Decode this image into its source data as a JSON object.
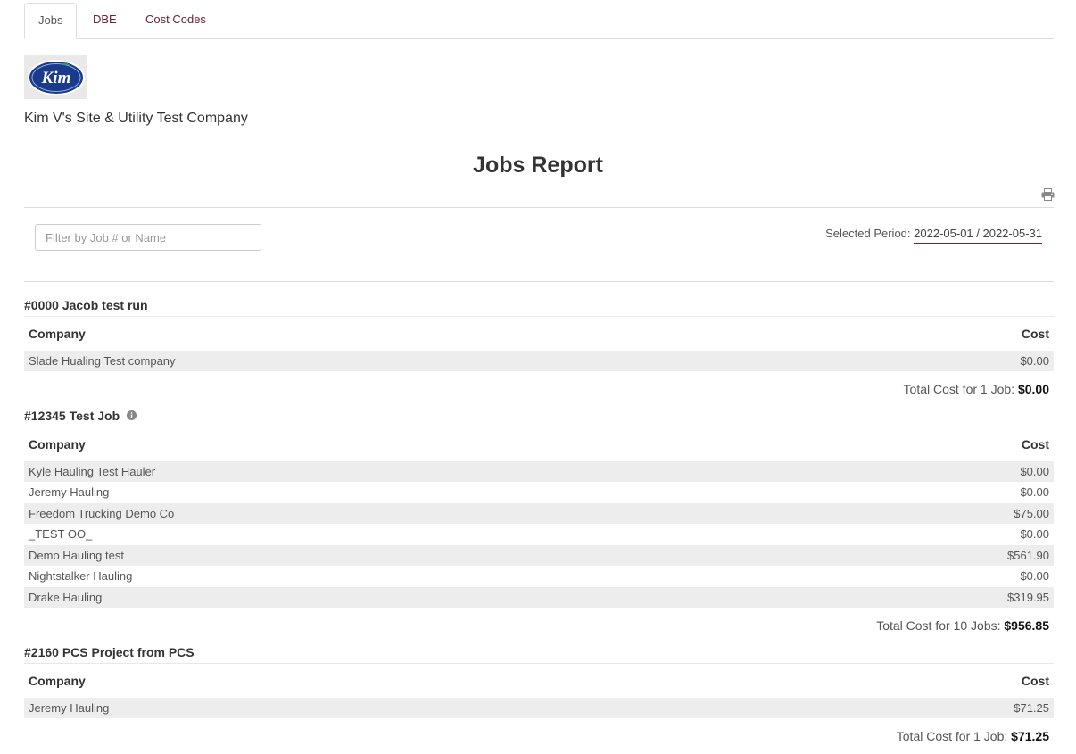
{
  "tabs": [
    {
      "label": "Jobs",
      "active": true
    },
    {
      "label": "DBE",
      "active": false
    },
    {
      "label": "Cost Codes",
      "active": false
    }
  ],
  "logo": {
    "text": "Kim",
    "icon": "company-logo"
  },
  "company": {
    "name": "Kim V's Site & Utility Test Company"
  },
  "report": {
    "title": "Jobs Report"
  },
  "toolbar": {
    "print_icon": "print-icon"
  },
  "filter": {
    "placeholder": "Filter by Job # or Name",
    "value": ""
  },
  "period": {
    "label": "Selected Period:",
    "value": "2022-05-01 / 2022-05-31"
  },
  "columns": {
    "company": "Company",
    "cost": "Cost"
  },
  "jobs": [
    {
      "title": "#0000 Jacob test run",
      "rows": [
        {
          "company": "Slade Hualing Test company",
          "cost": "$0.00"
        }
      ],
      "total_label": "Total Cost for 1 Job:",
      "total_value": "$0.00"
    },
    {
      "title": "#12345 Test Job",
      "has_info_icon": true,
      "rows": [
        {
          "company": "Kyle Hauling Test Hauler",
          "cost": "$0.00"
        },
        {
          "company": "Jeremy Hauling",
          "cost": "$0.00"
        },
        {
          "company": "Freedom Trucking Demo Co",
          "cost": "$75.00"
        },
        {
          "company": "_TEST OO_",
          "cost": "$0.00"
        },
        {
          "company": "Demo Hauling test",
          "cost": "$561.90"
        },
        {
          "company": "Nightstalker Hauling",
          "cost": "$0.00"
        },
        {
          "company": "Drake Hauling",
          "cost": "$319.95"
        }
      ],
      "total_label": "Total Cost for 10 Jobs:",
      "total_value": "$956.85"
    },
    {
      "title": "#2160 PCS Project from PCS",
      "rows": [
        {
          "company": "Jeremy Hauling",
          "cost": "$71.25"
        }
      ],
      "total_label": "Total Cost for 1 Job:",
      "total_value": "$71.25"
    }
  ]
}
